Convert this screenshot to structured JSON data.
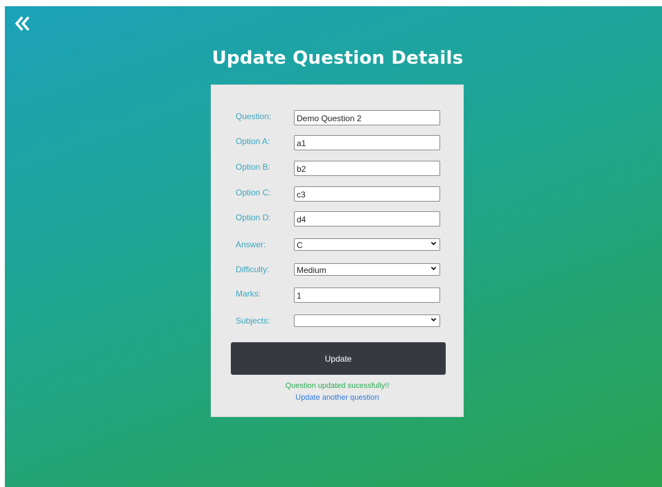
{
  "header": {
    "back_icon": "double-chevron-left-icon",
    "title": "Update Question Details"
  },
  "form": {
    "question": {
      "label": "Question:",
      "value": "Demo Question 2"
    },
    "option_a": {
      "label": "Option A:",
      "value": "a1"
    },
    "option_b": {
      "label": "Option B:",
      "value": "b2"
    },
    "option_c": {
      "label": "Option C:",
      "value": "c3"
    },
    "option_d": {
      "label": "Option D:",
      "value": "d4"
    },
    "answer": {
      "label": "Answer:",
      "value": "C"
    },
    "difficulty": {
      "label": "Difficulty:",
      "value": "Medium"
    },
    "marks": {
      "label": "Marks:",
      "value": "1"
    },
    "subjects": {
      "label": "Subjects:",
      "value": ""
    },
    "update_button": "Update",
    "success_message": "Question updated sucessfully!!",
    "another_link": "Update another question"
  },
  "colors": {
    "label": "#3aa6bd",
    "button_bg": "#363a40",
    "success": "#2eae55",
    "link": "#2d7be0",
    "card_bg": "#e9e9e9"
  }
}
